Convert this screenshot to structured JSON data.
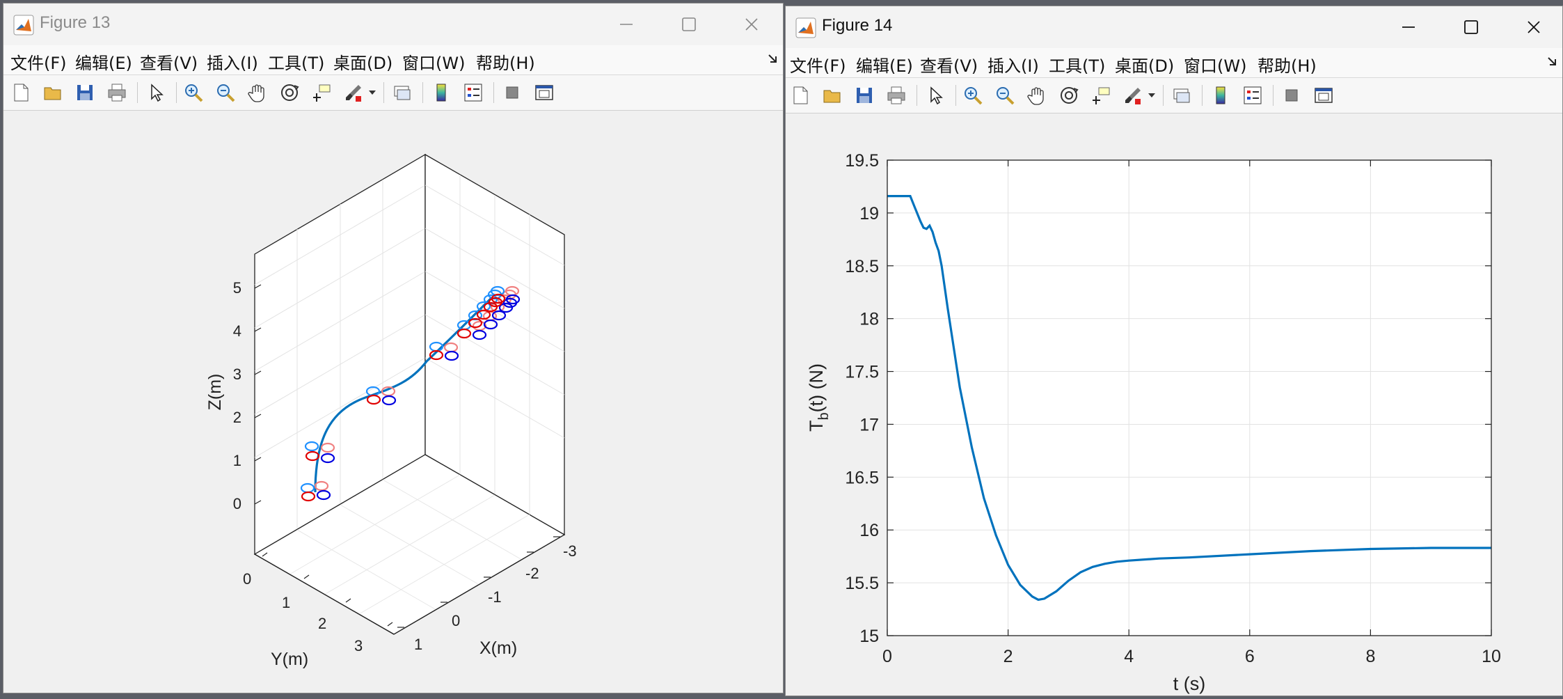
{
  "fig13": {
    "title": "Figure 13",
    "menu": [
      "文件(F)",
      "编辑(E)",
      "查看(V)",
      "插入(I)",
      "工具(T)",
      "桌面(D)",
      "窗口(W)",
      "帮助(H)"
    ],
    "axes": {
      "z_ticks": [
        "0",
        "1",
        "2",
        "3",
        "4",
        "5"
      ],
      "y_ticks": [
        "0",
        "1",
        "2",
        "3"
      ],
      "x_ticks": [
        "1",
        "0",
        "-1",
        "-2",
        "-3"
      ],
      "zlabel": "Z(m)",
      "ylabel": "Y(m)",
      "xlabel": "X(m)"
    }
  },
  "fig14": {
    "title": "Figure 14",
    "menu": [
      "文件(F)",
      "编辑(E)",
      "查看(V)",
      "插入(I)",
      "工具(T)",
      "桌面(D)",
      "窗口(W)",
      "帮助(H)"
    ]
  },
  "chart_data": {
    "type": "line",
    "title": "",
    "xlabel": "t (s)",
    "ylabel_main": "T",
    "ylabel_sub": "b",
    "ylabel_tail": "(t) (N)",
    "xlim": [
      0,
      10
    ],
    "ylim": [
      15,
      19.5
    ],
    "xticks": [
      0,
      2,
      4,
      6,
      8,
      10
    ],
    "yticks": [
      15,
      15.5,
      16,
      16.5,
      17,
      17.5,
      18,
      18.5,
      19,
      19.5
    ],
    "grid": true,
    "color": "#0072bd",
    "series": [
      {
        "x": [
          0,
          0.2,
          0.38,
          0.45,
          0.55,
          0.6,
          0.65,
          0.7,
          0.75,
          0.8,
          0.85,
          0.9,
          1.0,
          1.2,
          1.4,
          1.6,
          1.8,
          2.0,
          2.2,
          2.4,
          2.5,
          2.6,
          2.8,
          3.0,
          3.2,
          3.4,
          3.6,
          3.8,
          4.0,
          4.5,
          5.0,
          6.0,
          7.0,
          8.0,
          9.0,
          10.0
        ],
        "y": [
          19.16,
          19.16,
          19.16,
          19.06,
          18.92,
          18.86,
          18.85,
          18.88,
          18.82,
          18.72,
          18.64,
          18.5,
          18.1,
          17.35,
          16.78,
          16.3,
          15.95,
          15.67,
          15.48,
          15.37,
          15.34,
          15.35,
          15.42,
          15.52,
          15.6,
          15.65,
          15.68,
          15.7,
          15.71,
          15.73,
          15.74,
          15.77,
          15.8,
          15.82,
          15.83,
          15.83
        ]
      }
    ]
  }
}
